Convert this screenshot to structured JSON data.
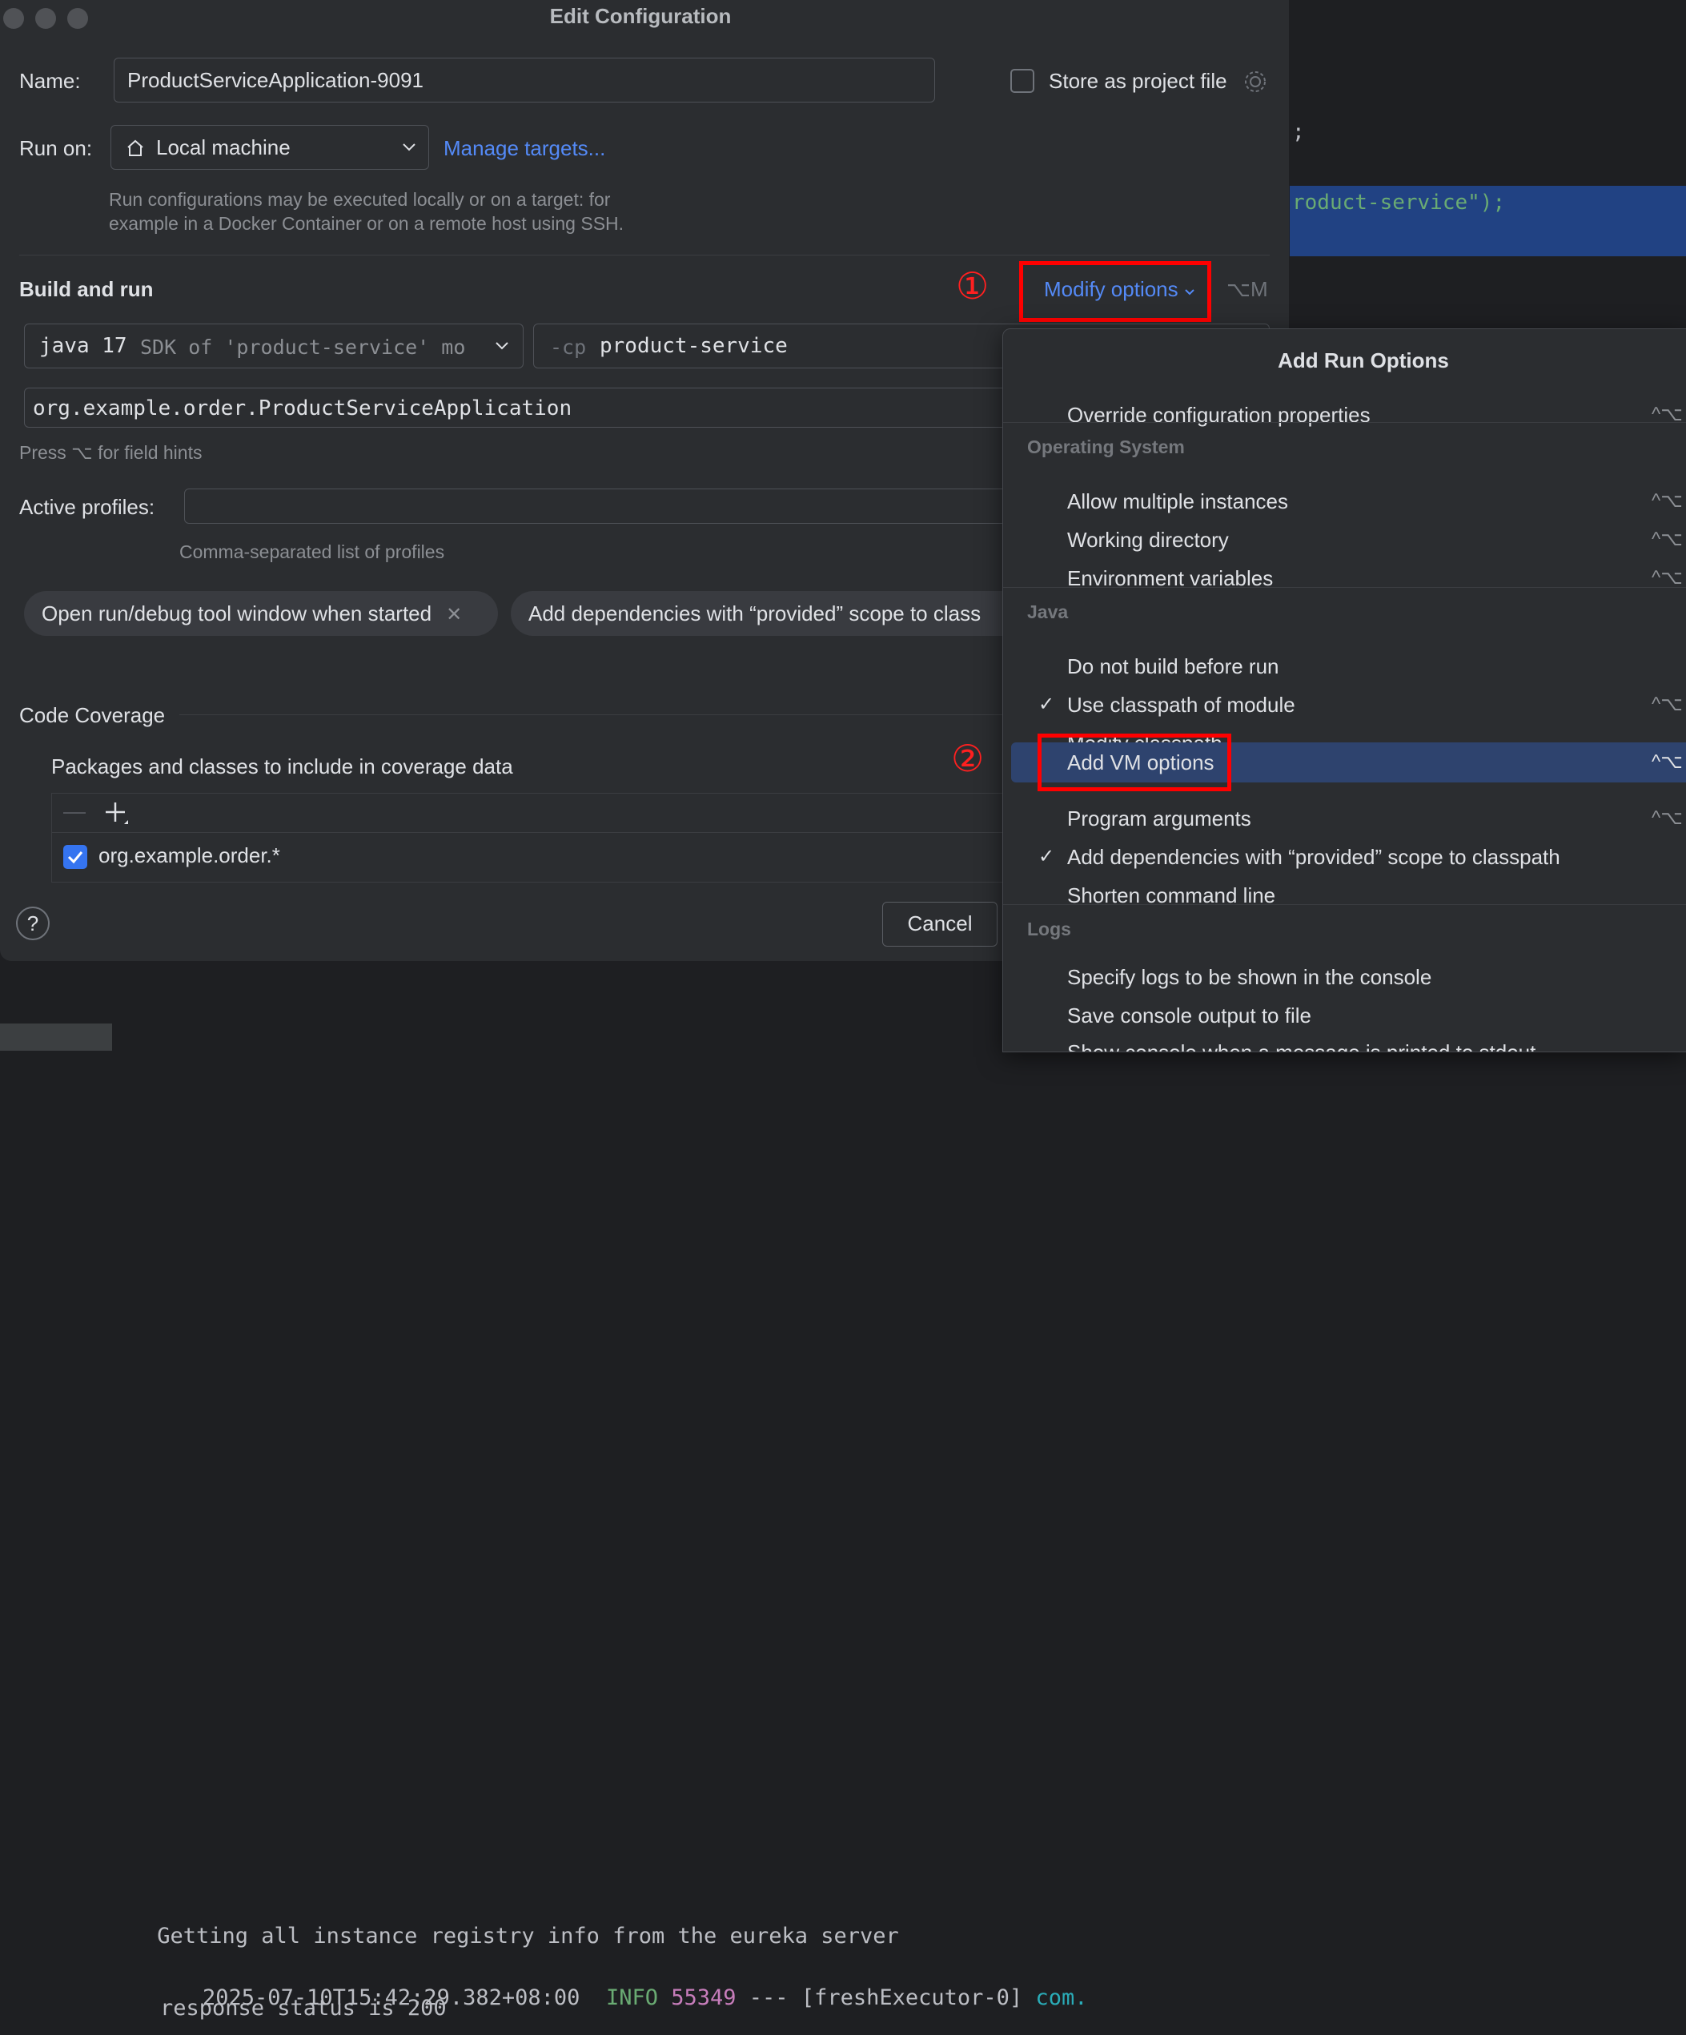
{
  "window": {
    "title": "Edit Configuration"
  },
  "name_field": {
    "label": "Name:",
    "value": "ProductServiceApplication-9091"
  },
  "store_project": {
    "label": "Store as project file"
  },
  "run_on": {
    "label": "Run on:",
    "value": "Local machine",
    "manage_link": "Manage targets...",
    "hint_line1": "Run configurations may be executed locally or on a target: for",
    "hint_line2": "example in a Docker Container or on a remote host using SSH."
  },
  "build_and_run": {
    "heading": "Build and run",
    "modify_options": "Modify options",
    "modify_shortcut": "⌥M",
    "sdk_main": "java 17",
    "sdk_sub": "SDK of 'product-service' mo",
    "cp_prefix": "-cp",
    "cp_value": "product-service",
    "main_class": "org.example.order.ProductServiceApplication",
    "field_hint": "Press ⌥ for field hints"
  },
  "profiles": {
    "label": "Active profiles:",
    "hint": "Comma-separated list of profiles"
  },
  "chips": [
    {
      "label": "Open run/debug tool window when started"
    },
    {
      "label": "Add dependencies with “provided” scope to class"
    }
  ],
  "coverage": {
    "heading": "Code Coverage",
    "packages_label": "Packages and classes to include in coverage data",
    "pattern": "org.example.order.*"
  },
  "footer": {
    "cancel": "Cancel",
    "help": "?"
  },
  "annotations": {
    "one": "①",
    "two": "②"
  },
  "popup": {
    "title": "Add Run Options",
    "items": [
      {
        "label": "Override configuration properties",
        "shortcut": "^⌥"
      },
      {
        "section": "Operating System"
      },
      {
        "label": "Allow multiple instances",
        "shortcut": "^⌥"
      },
      {
        "label": "Working directory",
        "shortcut": "^⌥"
      },
      {
        "label": "Environment variables",
        "shortcut": "^⌥"
      },
      {
        "section": "Java"
      },
      {
        "label": "Do not build before run"
      },
      {
        "label": "Use classpath of module",
        "shortcut": "^⌥",
        "check": "✓"
      },
      {
        "label": "Modify classpath"
      },
      {
        "label": "Add VM options",
        "shortcut": "^⌥"
      },
      {
        "label": "Program arguments",
        "shortcut": "^⌥"
      },
      {
        "label": "Add dependencies with “provided” scope to classpath",
        "check": "✓"
      },
      {
        "label": "Shorten command line"
      },
      {
        "section": "Logs"
      },
      {
        "label": "Specify logs to be shown in the console"
      },
      {
        "label": "Save console output to file"
      },
      {
        "label": "Show console when a message is printed to stdout"
      }
    ]
  },
  "editor": {
    "line1": ";",
    "line2": "roduct-service\");"
  },
  "console": {
    "line1": " Getting all instance registry info from the eureka server",
    "ts": "2025-07-10T15:42:29.382+08:00",
    "level": "INFO",
    "pid": "55349",
    "dashes": "---",
    "thread": "[freshExecutor-0]",
    "cls": "com.",
    "line3": "response status is 200"
  }
}
